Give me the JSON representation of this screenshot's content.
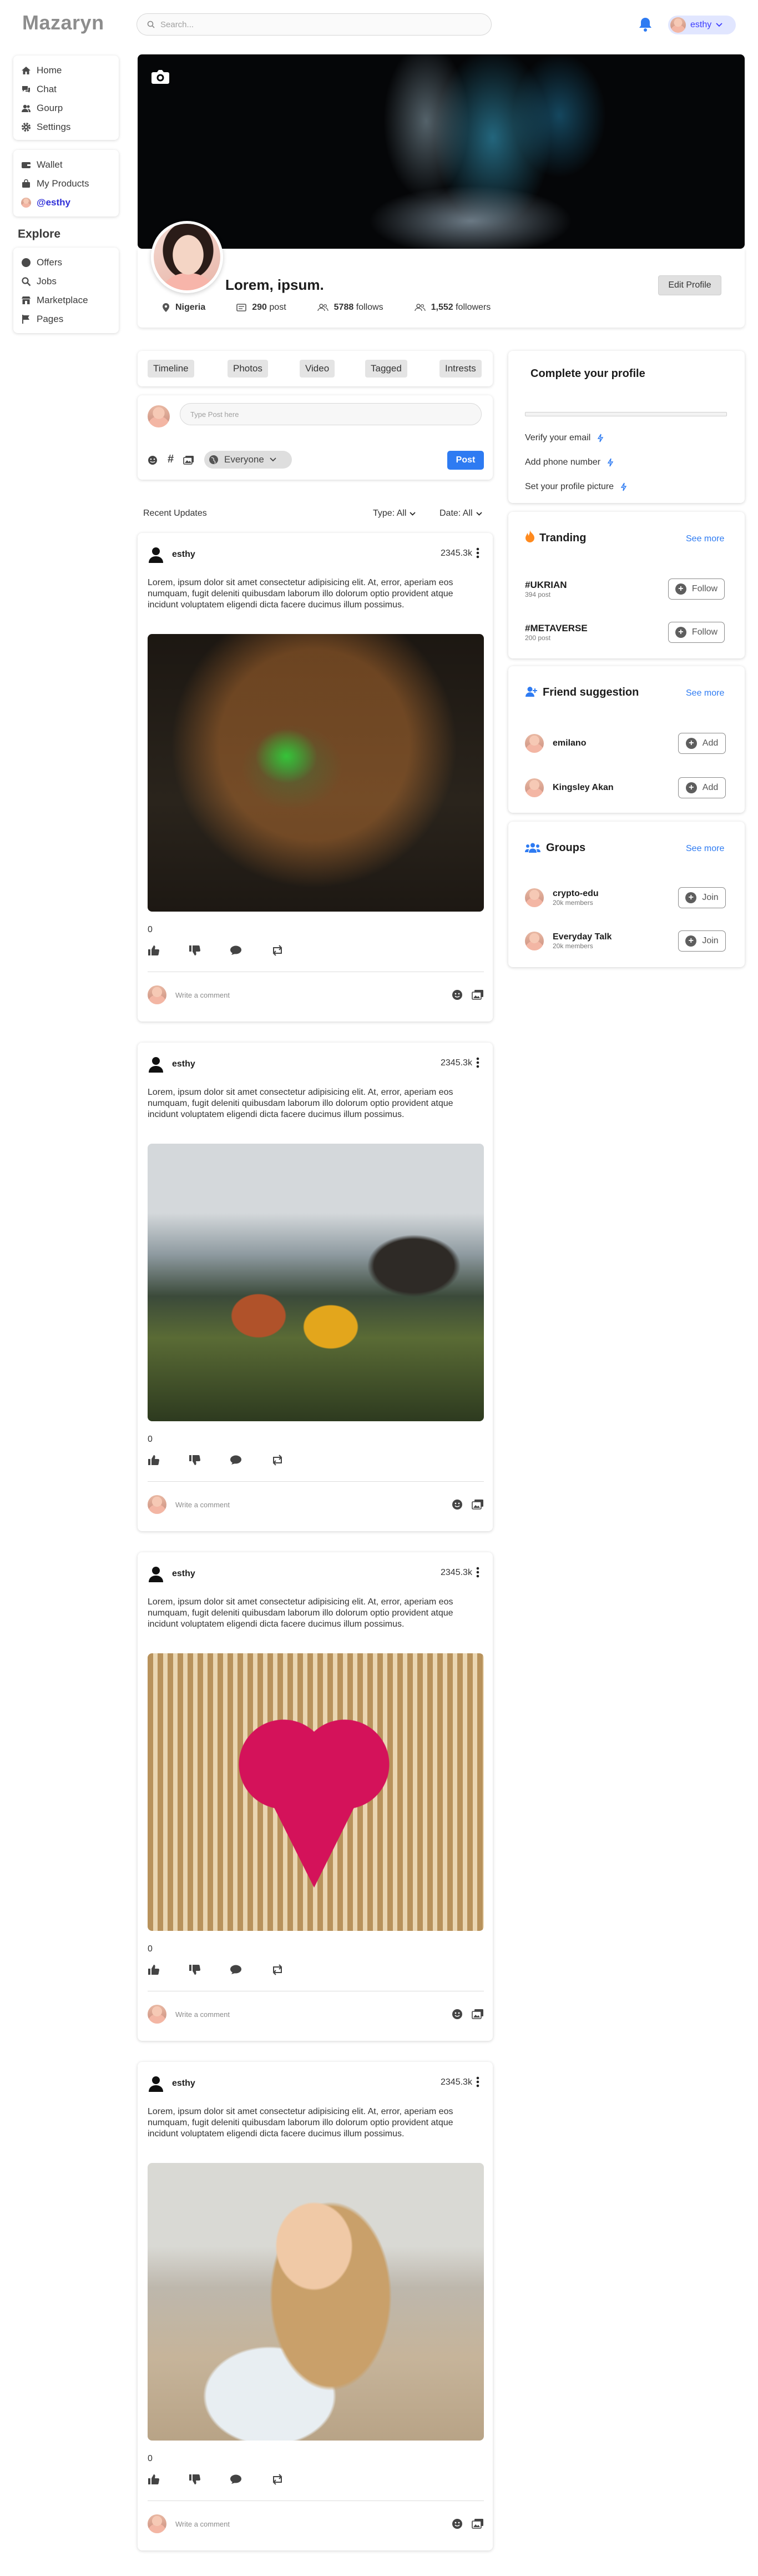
{
  "app": {
    "logo": "Mazaryn"
  },
  "search": {
    "placeholder": "Search..."
  },
  "user": {
    "name": "esthy"
  },
  "sidebar": {
    "main": [
      {
        "label": "Home",
        "icon": "home-icon"
      },
      {
        "label": "Chat",
        "icon": "chat-icon"
      },
      {
        "label": "Gourp",
        "icon": "group-icon"
      },
      {
        "label": "Settings",
        "icon": "gear-icon"
      }
    ],
    "secondary": [
      {
        "label": "Wallet",
        "icon": "wallet-icon"
      },
      {
        "label": "My Products",
        "icon": "bag-icon"
      },
      {
        "label": "@esthy",
        "icon": "avatar"
      }
    ],
    "explore_heading": "Explore",
    "explore": [
      {
        "label": "Offers",
        "icon": "offers-icon"
      },
      {
        "label": "Jobs",
        "icon": "search-icon"
      },
      {
        "label": "Marketplace",
        "icon": "store-icon"
      },
      {
        "label": "Pages",
        "icon": "flag-icon"
      }
    ]
  },
  "profile": {
    "name": "Lorem, ipsum.",
    "location": "Nigeria",
    "posts_count": "290",
    "posts_label": "post",
    "follows_count": "5788",
    "follows_label": "follows",
    "followers_count": "1,552",
    "followers_label": "followers",
    "edit_label": "Edit Profile"
  },
  "tabs": [
    "Timeline",
    "Photos",
    "Video",
    "Tagged",
    "Intrests"
  ],
  "composer": {
    "placeholder": "Type Post here",
    "audience": "Everyone",
    "post_label": "Post"
  },
  "feed": {
    "heading": "Recent Updates",
    "type_filter": "Type: All",
    "date_filter": "Date: All"
  },
  "posts": [
    {
      "author": "esthy",
      "time": "2345.3k",
      "text": "Lorem, ipsum dolor sit amet consectetur adipisicing elit. At, error, aperiam eos numquam, fugit deleniti quibusdam laborum illo dolorum optio provident atque incidunt voluptatem eligendi dicta facere ducimus illum possimus.",
      "count": "0",
      "comment_placeholder": "Write a comment"
    },
    {
      "author": "esthy",
      "time": "2345.3k",
      "text": "Lorem, ipsum dolor sit amet consectetur adipisicing elit. At, error, aperiam eos numquam, fugit deleniti quibusdam laborum illo dolorum optio provident atque incidunt voluptatem eligendi dicta facere ducimus illum possimus.",
      "count": "0",
      "comment_placeholder": "Write a comment"
    },
    {
      "author": "esthy",
      "time": "2345.3k",
      "text": "Lorem, ipsum dolor sit amet consectetur adipisicing elit. At, error, aperiam eos numquam, fugit deleniti quibusdam laborum illo dolorum optio provident atque incidunt voluptatem eligendi dicta facere ducimus illum possimus.",
      "count": "0",
      "comment_placeholder": "Write a comment"
    },
    {
      "author": "esthy",
      "time": "2345.3k",
      "text": "Lorem, ipsum dolor sit amet consectetur adipisicing elit. At, error, aperiam eos numquam, fugit deleniti quibusdam laborum illo dolorum optio provident atque incidunt voluptatem eligendi dicta facere ducimus illum possimus.",
      "count": "0",
      "comment_placeholder": "Write a comment"
    }
  ],
  "complete_profile": {
    "title": "Complete your profile",
    "progress": 0,
    "items": [
      "Verify your email",
      "Add phone number",
      "Set your profile picture"
    ]
  },
  "trending": {
    "title": "Tranding",
    "see_more": "See more",
    "items": [
      {
        "tag": "#UKRIAN",
        "count": "394 post",
        "action": "Follow"
      },
      {
        "tag": "#METAVERSE",
        "count": "200 post",
        "action": "Follow"
      }
    ]
  },
  "friends": {
    "title": "Friend suggestion",
    "see_more": "See more",
    "items": [
      {
        "name": "emilano",
        "action": "Add"
      },
      {
        "name": "Kingsley Akan",
        "action": "Add"
      }
    ]
  },
  "groups": {
    "title": "Groups",
    "see_more": "See more",
    "items": [
      {
        "name": "crypto-edu",
        "members": "20k members",
        "action": "Join"
      },
      {
        "name": "Everyday Talk",
        "members": "20k members",
        "action": "Join"
      }
    ]
  },
  "colors": {
    "accent": "#2e7bf2",
    "active_link": "#2f2fd8",
    "trend_flame": "#ff8a1e"
  }
}
